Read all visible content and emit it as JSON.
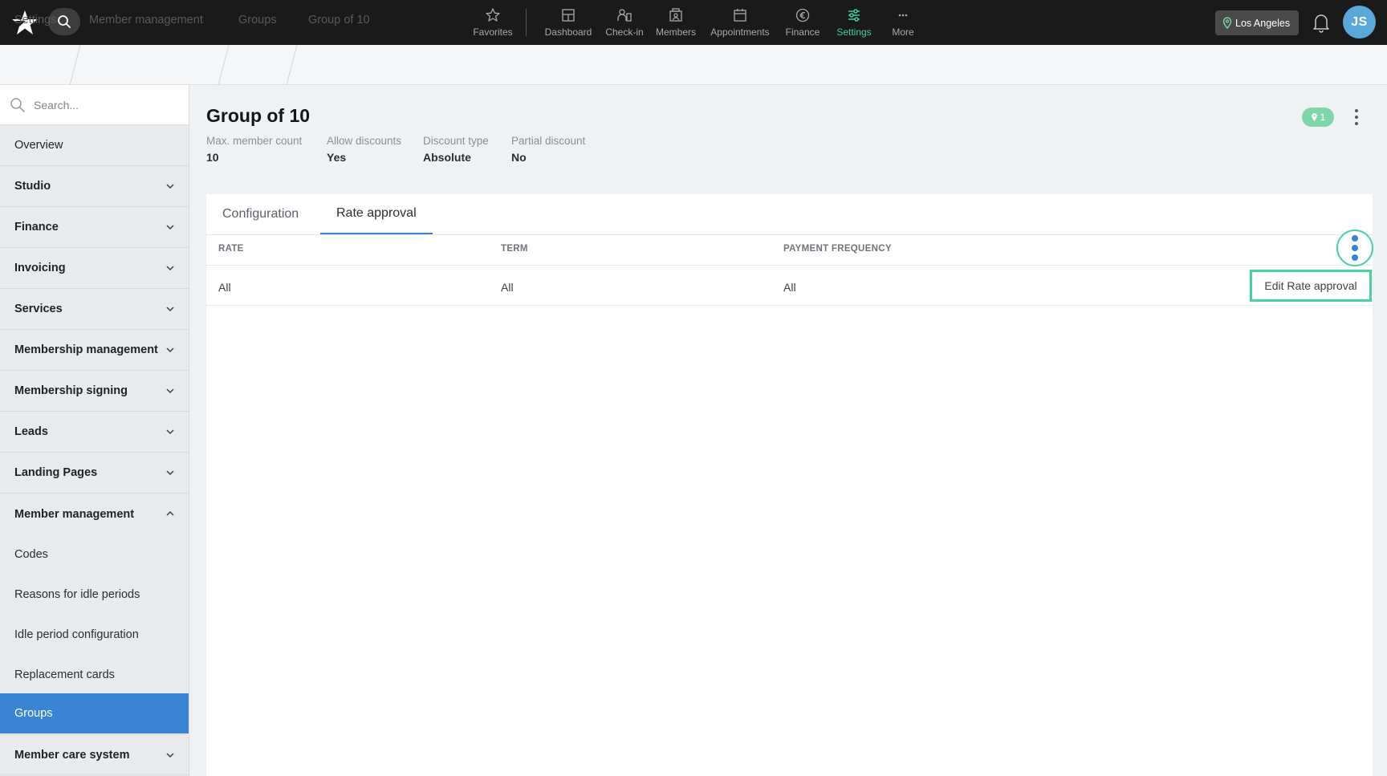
{
  "nav": {
    "items": [
      {
        "label": "Favorites",
        "icon": "star-icon"
      },
      {
        "label": "Dashboard",
        "icon": "dashboard-icon"
      },
      {
        "label": "Check-in",
        "icon": "check-in-icon"
      },
      {
        "label": "Members",
        "icon": "members-icon"
      },
      {
        "label": "Appointments",
        "icon": "calendar-icon"
      },
      {
        "label": "Finance",
        "icon": "euro-icon"
      },
      {
        "label": "Settings",
        "icon": "sliders-icon",
        "active": true
      },
      {
        "label": "More",
        "icon": "more-icon"
      }
    ],
    "location": "Los Angeles",
    "avatar_initials": "JS",
    "accent_color": "#3fcf9f"
  },
  "breadcrumb": [
    "Settings",
    "Member management",
    "Groups",
    "Group of 10"
  ],
  "sidebar": {
    "search_placeholder": "Search...",
    "items": [
      "Overview",
      "Studio",
      "Finance",
      "Invoicing",
      "Services",
      "Membership management",
      "Membership signing",
      "Leads",
      "Landing Pages",
      "Member management"
    ],
    "sub_items": [
      "Codes",
      "Reasons for idle periods",
      "Idle period configuration",
      "Replacement cards",
      "Groups"
    ],
    "active_sub_item": "Groups",
    "last_item": "Member care system",
    "active_color": "#3a84d4"
  },
  "header": {
    "title": "Group of 10",
    "location_badge_count": "1",
    "meta": [
      {
        "label": "Max. member count",
        "value": "10"
      },
      {
        "label": "Allow discounts",
        "value": "Yes"
      },
      {
        "label": "Discount type",
        "value": "Absolute"
      },
      {
        "label": "Partial discount",
        "value": "No"
      }
    ]
  },
  "tabs": [
    "Configuration",
    "Rate approval"
  ],
  "active_tab": "Rate approval",
  "table": {
    "columns": [
      "RATE",
      "TERM",
      "PAYMENT FREQUENCY"
    ],
    "rows": [
      [
        "All",
        "All",
        "All"
      ]
    ]
  },
  "row_menu": {
    "edit_label": "Edit Rate approval"
  }
}
